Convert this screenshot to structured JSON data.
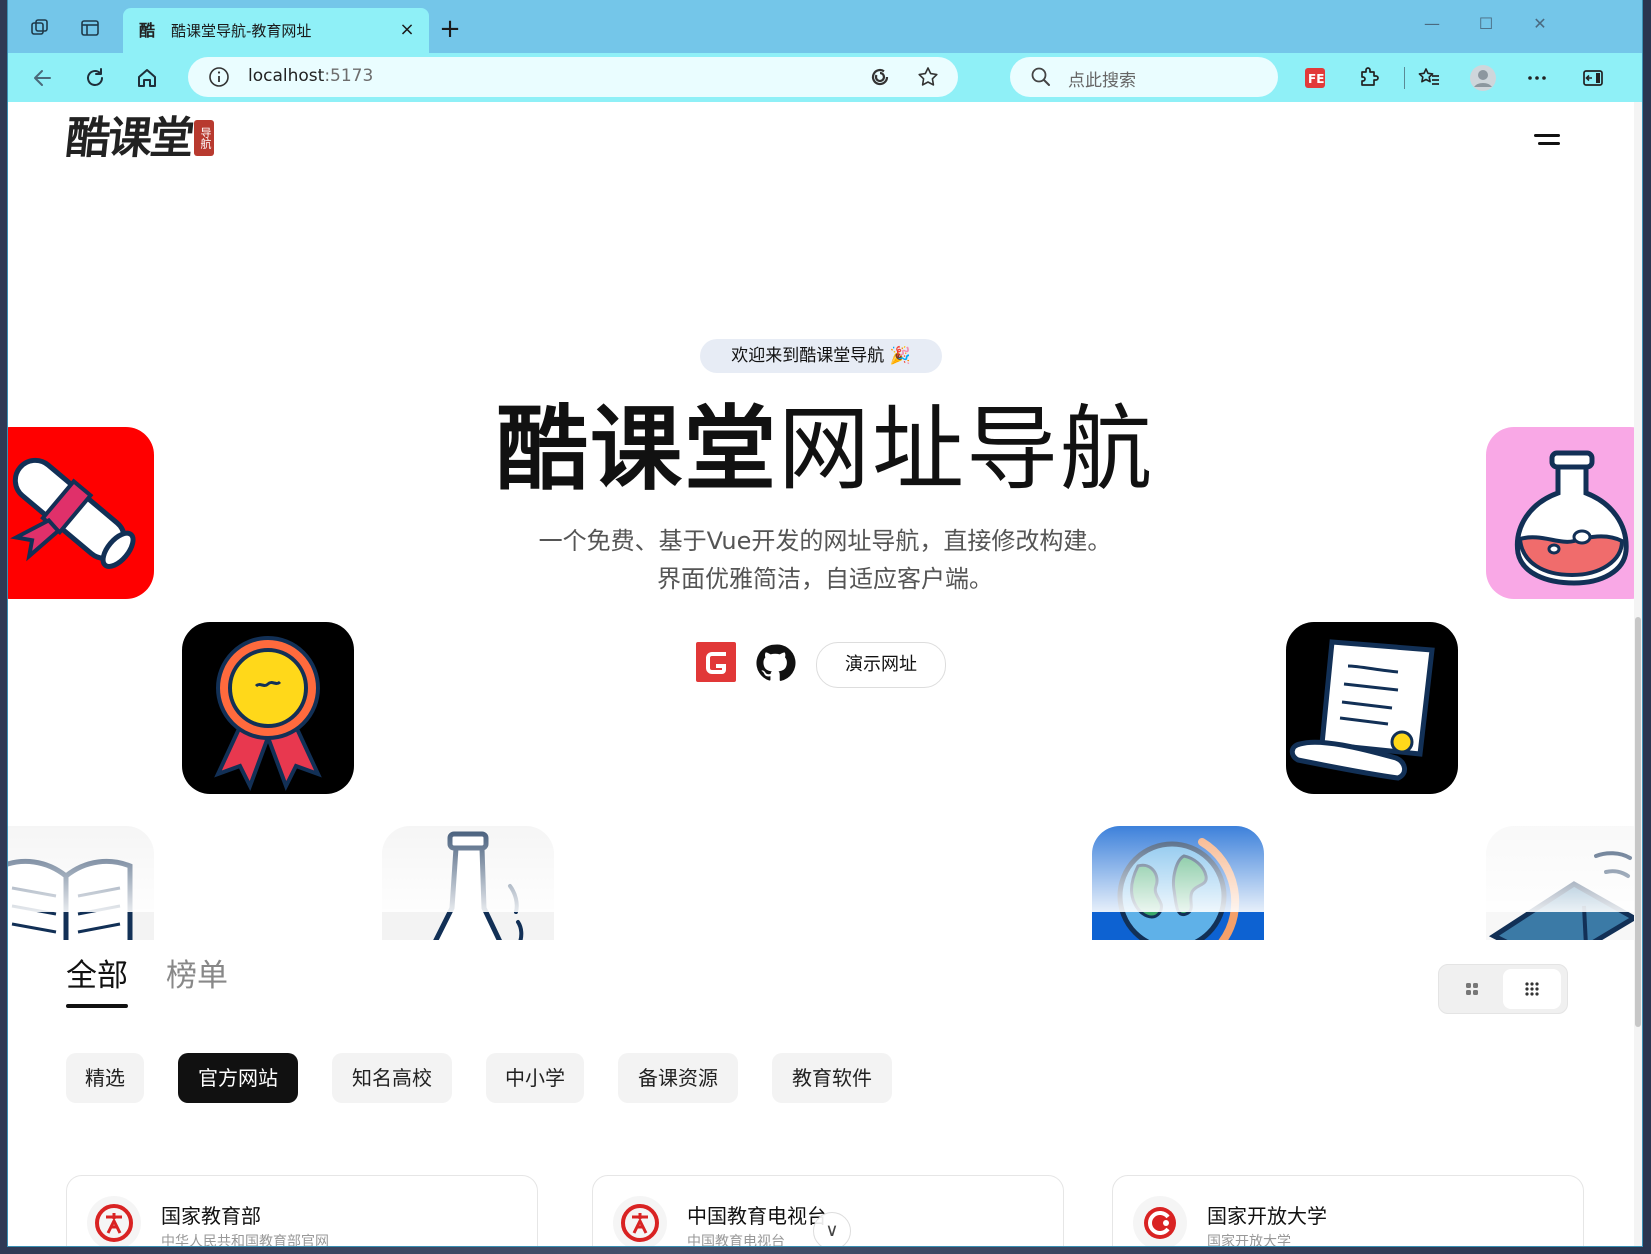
{
  "browser": {
    "tab": {
      "favicon_char": "酷",
      "title": "酷课堂导航-教育网址",
      "close": "×"
    },
    "new_tab": "+",
    "window_controls": {
      "minimize": "—",
      "maximize": "☐",
      "close": "✕"
    },
    "address": {
      "host": "localhost",
      "port": ":5173"
    },
    "search": {
      "placeholder": "点此搜索"
    },
    "icons": [
      "back-icon",
      "refresh-icon",
      "home-icon",
      "info-icon",
      "sync-icon",
      "favorite-star-icon",
      "search-icon",
      "fe-extension-icon",
      "extensions-puzzle-icon",
      "favorites-list-icon",
      "profile-icon",
      "more-icon",
      "sidebar-icon"
    ]
  },
  "header": {
    "logo_text": "酷课堂",
    "logo_seal": "导航"
  },
  "hero": {
    "welcome": "欢迎来到酷课堂导航 🎉",
    "title_bold": "酷课堂",
    "title_rest": "网址导航",
    "subtitle_line1": "一个免费、基于Vue开发的网址导航，直接修改构建。",
    "subtitle_line2": "界面优雅简洁，自适应客户端。",
    "demo_button": "演示网址"
  },
  "main_tabs": [
    {
      "label": "全部",
      "active": true
    },
    {
      "label": "榜单",
      "active": false
    }
  ],
  "categories": [
    {
      "label": "精选",
      "active": false
    },
    {
      "label": "官方网站",
      "active": true
    },
    {
      "label": "知名高校",
      "active": false
    },
    {
      "label": "中小学",
      "active": false
    },
    {
      "label": "备课资源",
      "active": false
    },
    {
      "label": "教育软件",
      "active": false
    }
  ],
  "cards": [
    {
      "title": "国家教育部",
      "desc": "中华人民共和国教育部官网"
    },
    {
      "title": "中国教育电视台",
      "desc": "中国教育电视台"
    },
    {
      "title": "国家开放大学",
      "desc": "国家开放大学"
    }
  ],
  "scroll_hint": "∨",
  "colors": {
    "tabbar": "#74c6e9",
    "toolbar": "#8ff0f7",
    "accent_red": "#e13838",
    "active_chip": "#111111"
  }
}
